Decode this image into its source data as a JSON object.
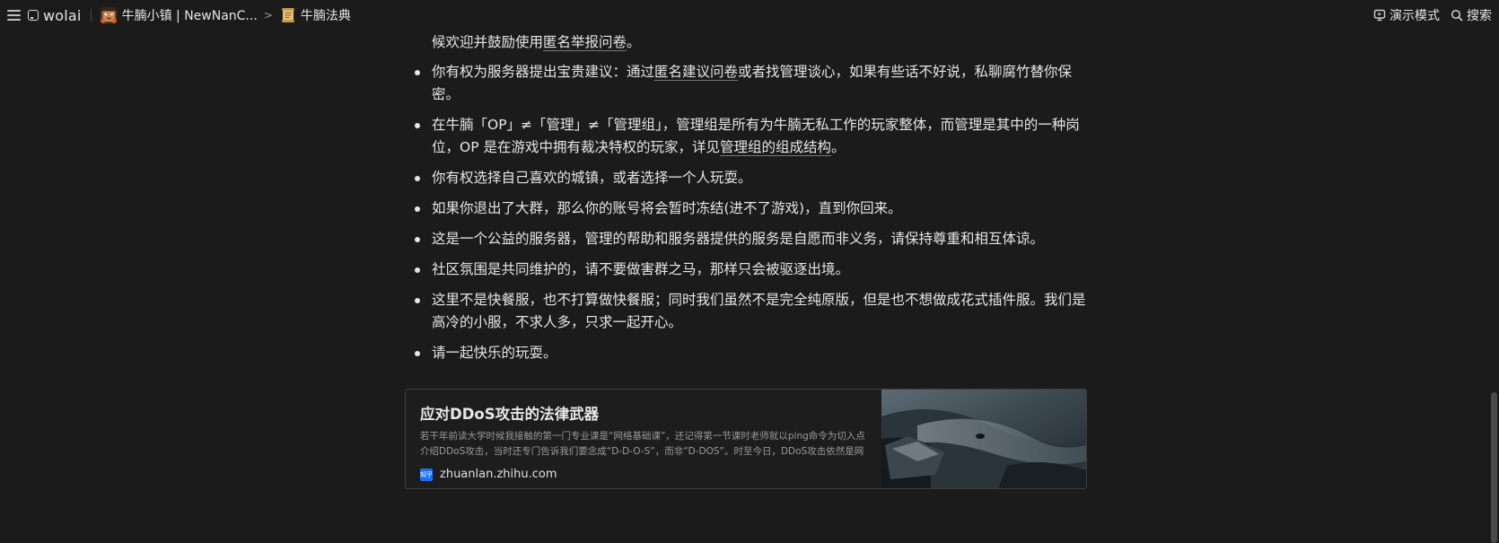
{
  "topbar": {
    "brand": "wolai",
    "breadcrumb": [
      {
        "label": "牛腩小镇 | NewNanC..."
      },
      {
        "label": "牛腩法典"
      }
    ],
    "present_label": "演示模式",
    "search_label": "搜索"
  },
  "content": {
    "top_fragment": {
      "before": "候欢迎并鼓励使用",
      "link": "匿名举报问卷",
      "after": "。"
    },
    "bullets": [
      {
        "before": "你有权为服务器提出宝贵建议：通过",
        "link": "匿名建议问卷",
        "after": "或者找管理谈心，如果有些话不好说，私聊腐竹替你保密。"
      },
      {
        "before": "在牛腩「OP」≠「管理」≠「管理组」，管理组是所有为牛腩无私工作的玩家整体，而管理是其中的一种岗位，OP 是在游戏中拥有裁决特权的玩家，详见",
        "link": "管理组的组成结构",
        "after": "。"
      },
      {
        "text": "你有权选择自己喜欢的城镇，或者选择一个人玩耍。"
      },
      {
        "text": "如果你退出了大群，那么你的账号将会暂时冻结(进不了游戏)，直到你回来。"
      },
      {
        "text": "这是一个公益的服务器，管理的帮助和服务器提供的服务是自愿而非义务，请保持尊重和相互体谅。"
      },
      {
        "text": "社区氛围是共同维护的，请不要做害群之马，那样只会被驱逐出境。"
      },
      {
        "text": "这里不是快餐服，也不打算做快餐服；同时我们虽然不是完全纯原版，但是也不想做成花式插件服。我们是高冷的小服，不求人多，只求一起开心。"
      },
      {
        "text": "请一起快乐的玩耍。"
      }
    ]
  },
  "link_card": {
    "title": "应对DDoS攻击的法律武器",
    "description": "若干年前读大学时候我接触的第一门专业课是“网络基础课”，还记得第一节课时老师就以ping命令为切入点介绍DDoS攻击，当时还专门告诉我们要念成“D-D-O-S”，而非“D-DOS”。时至今日，DDoS攻击依然是网络",
    "source_icon_text": "知乎",
    "source_host": "zhuanlan.zhihu.com"
  },
  "colors": {
    "background": "#1b1b1b",
    "text": "#e6e6e6",
    "card_border": "#3d3d3d",
    "zhihu_blue": "#1772f6"
  }
}
